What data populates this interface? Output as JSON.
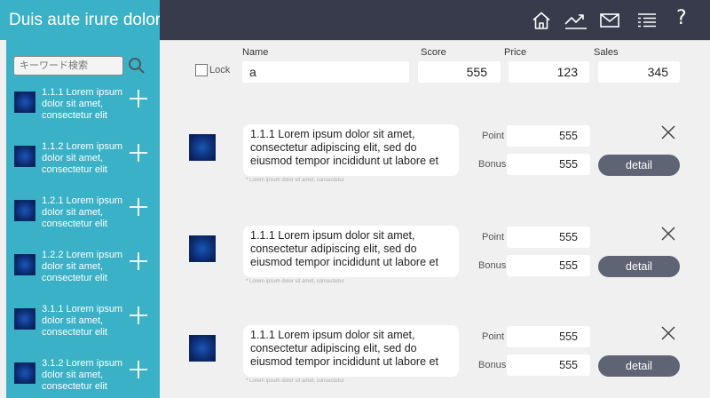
{
  "sidebar": {
    "title": "Duis aute irure dolor",
    "search": {
      "placeholder": "キーワード検索",
      "value": ""
    },
    "items": [
      {
        "label": "1.1.1 Lorem ipsum dolor sit amet, consectetur elit"
      },
      {
        "label": "1.1.2 Lorem ipsum dolor sit amet, consectetur elit"
      },
      {
        "label": "1.2.1 Lorem ipsum dolor sit amet, consectetur elit"
      },
      {
        "label": "1.2.2 Lorem ipsum dolor sit amet, consectetur elit"
      },
      {
        "label": "3.1.1 Lorem ipsum dolor sit amet, consectetur elit"
      },
      {
        "label": "3.1.2 Lorem ipsum dolor sit amet, consectetur elit"
      }
    ]
  },
  "header": {
    "icons": [
      "home-icon",
      "trend-chart-icon",
      "mail-icon",
      "list-icon",
      "help-icon"
    ],
    "help_glyph": "?"
  },
  "form": {
    "lock_label": "Lock",
    "name_label": "Name",
    "name_value": "a",
    "score_label": "Score",
    "score_value": "555",
    "price_label": "Price",
    "price_value": "123",
    "sales_label": "Sales",
    "sales_value": "345"
  },
  "rows": [
    {
      "text": "1.1.1 Lorem ipsum dolor sit amet, consectetur adipiscing elit, sed do eiusmod tempor incididunt ut labore et",
      "caption": "* Lorem ipsum dolor sit amet, consectetur",
      "point_label": "Point",
      "point_value": "555",
      "bonus_label": "Bonus",
      "bonus_value": "555",
      "detail_label": "detail"
    },
    {
      "text": "1.1.1 Lorem ipsum dolor sit amet, consectetur adipiscing elit, sed do eiusmod tempor incididunt ut labore et",
      "caption": "* Lorem ipsum dolor sit amet, consectetur",
      "point_label": "Point",
      "point_value": "555",
      "bonus_label": "Bonus",
      "bonus_value": "555",
      "detail_label": "detail"
    },
    {
      "text": "1.1.1 Lorem ipsum dolor sit amet, consectetur adipiscing elit, sed do eiusmod tempor incididunt ut labore et",
      "caption": "* Lorem ipsum dolor sit amet, consectetur",
      "point_label": "Point",
      "point_value": "555",
      "bonus_label": "Bonus",
      "bonus_value": "555",
      "detail_label": "detail"
    }
  ],
  "colors": {
    "sidebar_bg": "#3ab1c6",
    "header_bg": "#383b4b",
    "main_bg": "#f0f0f0",
    "detail_button": "#5f6475"
  }
}
